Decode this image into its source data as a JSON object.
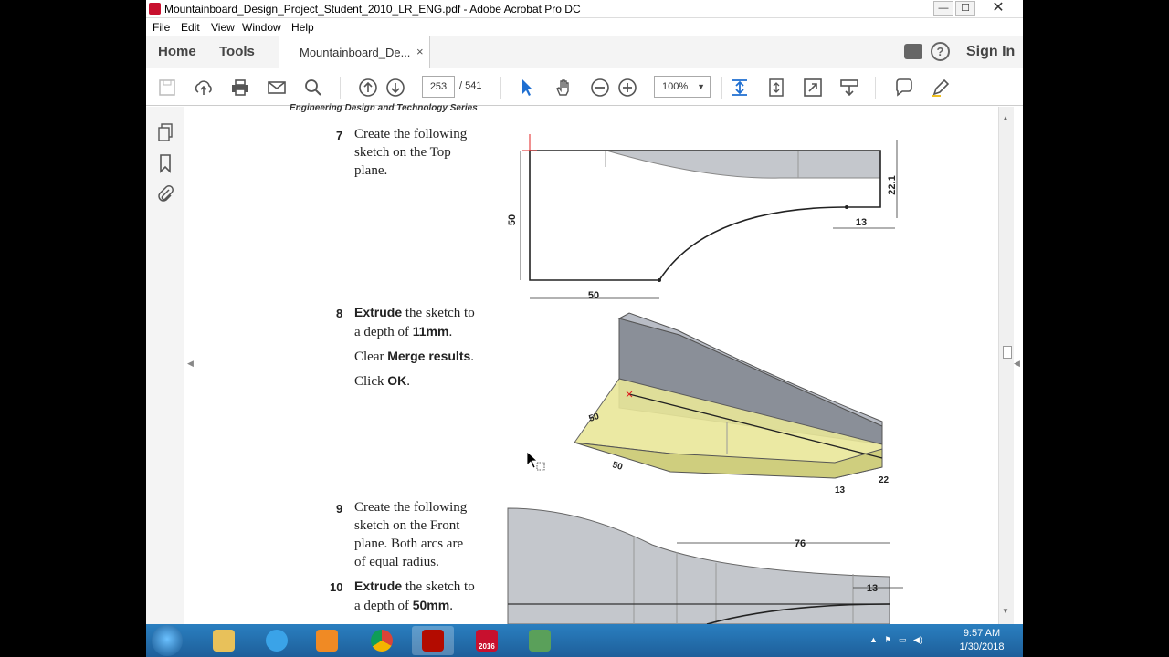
{
  "window": {
    "title": "Mountainboard_Design_Project_Student_2010_LR_ENG.pdf - Adobe Acrobat Pro DC",
    "controls": {
      "minimize": "—",
      "maximize": "☐",
      "close": "✕"
    }
  },
  "menu": [
    "File",
    "Edit",
    "View",
    "Window",
    "Help"
  ],
  "tabs": {
    "home": "Home",
    "tools": "Tools",
    "document": "Mountainboard_De...",
    "close": "×",
    "sign_in": "Sign In"
  },
  "toolbar": {
    "page_current": "253",
    "page_total": "/ 541",
    "zoom": "100%",
    "zoom_caret": "▼"
  },
  "document": {
    "series_header": "Engineering Design and Technology Series",
    "steps": [
      {
        "number": "7",
        "lines": [
          "Create the following",
          "sketch on the Top",
          "plane."
        ]
      },
      {
        "number": "8",
        "text_a": "Extrude",
        "text_b": " the sketch to",
        "line2a": "a depth of ",
        "line2b": "11mm",
        "line2c": ".",
        "line3a": "Clear ",
        "line3b": "Merge results",
        "line3c": ".",
        "line4a": "Click ",
        "line4b": "OK",
        "line4c": "."
      },
      {
        "number": "9",
        "lines": [
          "Create the following",
          "sketch on the Front",
          "plane. Both arcs are",
          "of equal radius."
        ]
      },
      {
        "number": "10",
        "text_a": "Extrude",
        "text_b": " the sketch to",
        "line2a": "a depth of ",
        "line2b": "50mm",
        "line2c": "."
      }
    ],
    "dims": {
      "fig7_height": "50",
      "fig7_width": "50",
      "fig7_thickness": "22.1",
      "fig7_tail": "13",
      "fig8_a": "50",
      "fig8_b": "50",
      "fig8_c": "22",
      "fig8_d": "13",
      "fig9_len": "76",
      "fig9_end": "13"
    }
  },
  "taskbar": {
    "clock_time": "9:57 AM",
    "clock_date": "1/30/2018",
    "sw_badge": "2016"
  }
}
